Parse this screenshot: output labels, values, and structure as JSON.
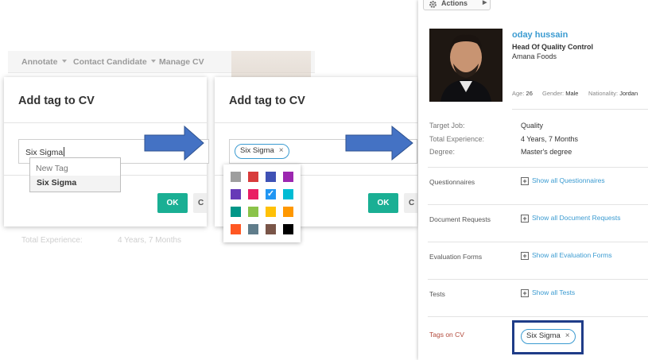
{
  "background_toolbar": {
    "items": [
      {
        "label": "Annotate",
        "has_caret": true
      },
      {
        "label": "Contact Candidate",
        "has_caret": true
      },
      {
        "label": "Manage CV",
        "has_caret": false
      }
    ],
    "ghost_row": {
      "label": "Total Experience:",
      "value": "4 Years, 7 Months"
    }
  },
  "dialog1": {
    "title": "Add tag to CV",
    "input_value": "Six Sigma",
    "dropdown_header": "New Tag",
    "dropdown_option": "Six Sigma",
    "ok_label": "OK",
    "cancel_label": "C"
  },
  "dialog2": {
    "title": "Add tag to CV",
    "chip_label": "Six Sigma",
    "chip_remove": "×",
    "ok_label": "OK",
    "cancel_label": "C",
    "palette": {
      "colors": [
        "#9e9e9e",
        "#d83b3b",
        "#3f51b5",
        "#9c27b0",
        "#673ab7",
        "#e91e63",
        "#2196f3",
        "#00bcd4",
        "#009688",
        "#8bc34a",
        "#ffc107",
        "#ff9800",
        "#ff5722",
        "#607d8b",
        "#795548",
        "#000000"
      ],
      "selected_index": 6,
      "check_glyph": "✓"
    }
  },
  "profile": {
    "actions_label": "Actions",
    "name": "oday hussain",
    "job_title": "Head Of Quality Control",
    "company": "Amana Foods",
    "meta": [
      {
        "label": "Age:",
        "value": "26"
      },
      {
        "label": "Gender:",
        "value": "Male"
      },
      {
        "label": "Nationality:",
        "value": "Jordan"
      }
    ],
    "details": [
      {
        "label": "Target Job:",
        "value": "Quality"
      },
      {
        "label": "Total Experience:",
        "value": "4 Years, 7 Months"
      },
      {
        "label": "Degree:",
        "value": "Master's degree"
      }
    ],
    "sections": [
      {
        "label": "Questionnaires",
        "link": "Show all Questionnaires"
      },
      {
        "label": "Document Requests",
        "link": "Show all Document Requests"
      },
      {
        "label": "Evaluation Forms",
        "link": "Show all Evaluation Forms"
      },
      {
        "label": "Tests",
        "link": "Show all Tests"
      }
    ],
    "tags_label": "Tags on CV",
    "tag_chip": "Six Sigma",
    "tag_remove": "×",
    "colors": {
      "link": "#3b9bd1",
      "tags_label": "#b34a3c",
      "highlight_box": "#1f3c88",
      "ok_button": "#1aaf94",
      "arrow": "#4472c4"
    }
  }
}
